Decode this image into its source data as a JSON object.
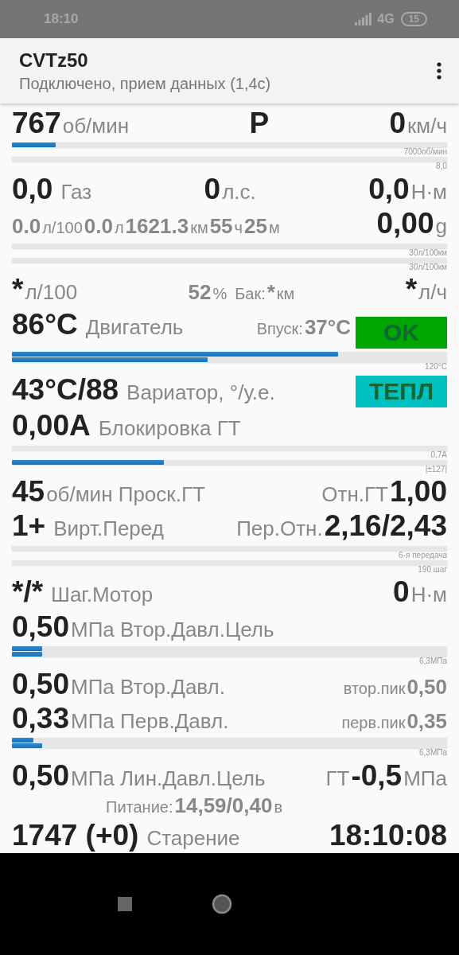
{
  "status_bar": {
    "time": "18:10",
    "network": "4G",
    "battery": "15"
  },
  "app_bar": {
    "title": "CVTz50",
    "subtitle": "Подключено, прием данных (1,4с)"
  },
  "rows": [
    {
      "kind": "values",
      "left": [
        {
          "kind": "value",
          "text": "767"
        },
        {
          "kind": "unit",
          "text": "об/мин"
        }
      ],
      "center": [
        {
          "kind": "value",
          "text": "P"
        }
      ],
      "right": [
        {
          "kind": "value",
          "text": "0"
        },
        {
          "kind": "unit",
          "text": "км/ч"
        }
      ]
    },
    {
      "kind": "bars",
      "bars": [
        {
          "level": 0.1,
          "caption": "7000об/мин"
        },
        {
          "caption": "8,0"
        }
      ]
    },
    {
      "kind": "values",
      "left": [
        {
          "kind": "value",
          "text": "0,0"
        },
        {
          "kind": "label",
          "text": "Газ"
        }
      ],
      "center": [
        {
          "kind": "value",
          "text": "0"
        },
        {
          "kind": "unit",
          "text": "л.с."
        }
      ],
      "right": [
        {
          "kind": "value",
          "text": "0,0"
        },
        {
          "kind": "unit",
          "text": "Н·м"
        }
      ]
    },
    {
      "kind": "values",
      "left": [
        {
          "kind": "dim_value",
          "text": "0.0"
        },
        {
          "kind": "small_unit",
          "text": "л/100"
        },
        {
          "kind": "dim_value",
          "text": "0.0"
        },
        {
          "kind": "small_unit",
          "text": "л"
        },
        {
          "kind": "dim_value",
          "text": "1621.3"
        },
        {
          "kind": "small_unit",
          "text": "км"
        },
        {
          "kind": "dim_value",
          "text": "55"
        },
        {
          "kind": "small_unit",
          "text": "ч"
        },
        {
          "kind": "dim_value",
          "text": "25"
        },
        {
          "kind": "small_unit",
          "text": "м"
        }
      ],
      "right": [
        {
          "kind": "value",
          "text": "0,00"
        },
        {
          "kind": "unit",
          "text": "g"
        }
      ]
    },
    {
      "kind": "bars",
      "bars": [
        {
          "caption": "30л/100км"
        },
        {
          "caption": "30л/100км"
        }
      ]
    },
    {
      "kind": "values",
      "left": [
        {
          "kind": "value",
          "text": "*"
        },
        {
          "kind": "unit",
          "text": "л/100"
        }
      ],
      "center": [
        {
          "kind": "dim_value",
          "text": "52"
        },
        {
          "kind": "small_unit",
          "text": "%"
        },
        {
          "kind": "small_label",
          "text": "Бак:"
        },
        {
          "kind": "dim_value",
          "text": "*"
        },
        {
          "kind": "small_unit",
          "text": "км"
        }
      ],
      "right": [
        {
          "kind": "value",
          "text": "*"
        },
        {
          "kind": "unit",
          "text": "л/ч"
        }
      ]
    },
    {
      "kind": "values",
      "left": [
        {
          "kind": "value",
          "text": "86°C"
        },
        {
          "kind": "label",
          "text": "Двигатель"
        }
      ],
      "right": [
        {
          "kind": "small_label",
          "text": "Впуск:"
        },
        {
          "kind": "dim_value",
          "text": "37°C"
        },
        {
          "kind": "badge",
          "text": "OK",
          "color": "#00a600"
        }
      ]
    },
    {
      "kind": "bars",
      "bars": [
        {
          "level": 0.75
        },
        {
          "level": 0.45,
          "caption": "120°C"
        }
      ]
    },
    {
      "kind": "values",
      "left": [
        {
          "kind": "value",
          "text": "43°C/88"
        },
        {
          "kind": "label",
          "text": "Вариатор, °/у.е."
        }
      ],
      "right": [
        {
          "kind": "badge",
          "text": "ТЕПЛ",
          "color": "#00c0c0"
        }
      ]
    },
    {
      "kind": "values",
      "left": [
        {
          "kind": "value",
          "text": "0,00A"
        },
        {
          "kind": "label",
          "text": "Блокировка ГТ"
        }
      ]
    },
    {
      "kind": "bars",
      "bars": [
        {
          "caption": "0,7А"
        },
        {
          "level": 0.35,
          "caption": "|±127|"
        }
      ]
    },
    {
      "kind": "values",
      "left": [
        {
          "kind": "value",
          "text": "45"
        },
        {
          "kind": "unit",
          "text": "об/мин Проск.ГТ"
        }
      ],
      "right": [
        {
          "kind": "label",
          "text": "Отн.ГТ"
        },
        {
          "kind": "value",
          "text": "1,00"
        }
      ]
    },
    {
      "kind": "values",
      "left": [
        {
          "kind": "value",
          "text": "1+"
        },
        {
          "kind": "label",
          "text": "Вирт.Перед"
        }
      ],
      "right": [
        {
          "kind": "unit",
          "text": "Пер.Отн."
        },
        {
          "kind": "value",
          "text": "2,16/2,43"
        }
      ]
    },
    {
      "kind": "bars",
      "bars": [
        {
          "caption": "6-я передача"
        },
        {
          "caption": "190 шаг"
        }
      ]
    },
    {
      "kind": "values",
      "left": [
        {
          "kind": "value",
          "text": "*/*"
        },
        {
          "kind": "label",
          "text": "Шаг.Мотор"
        }
      ],
      "right": [
        {
          "kind": "value",
          "text": "0"
        },
        {
          "kind": "unit",
          "text": "Н·м"
        }
      ]
    },
    {
      "kind": "values",
      "left": [
        {
          "kind": "value",
          "text": "0,50"
        },
        {
          "kind": "unit",
          "text": "МПа Втор.Давл.Цель"
        }
      ]
    },
    {
      "kind": "bars",
      "bars": [
        {
          "level": 0.07
        },
        {
          "level": 0.07,
          "caption": "6,3МПа"
        }
      ]
    },
    {
      "kind": "values",
      "left": [
        {
          "kind": "value",
          "text": "0,50"
        },
        {
          "kind": "unit",
          "text": "МПа Втор.Давл."
        }
      ],
      "right": [
        {
          "kind": "small_label",
          "text": "втор.пик"
        },
        {
          "kind": "dim_value",
          "text": "0,50"
        }
      ]
    },
    {
      "kind": "values",
      "left": [
        {
          "kind": "value",
          "text": "0,33"
        },
        {
          "kind": "unit",
          "text": "МПа Перв.Давл."
        }
      ],
      "right": [
        {
          "kind": "small_label",
          "text": "перв.пик"
        },
        {
          "kind": "dim_value",
          "text": "0,35"
        }
      ]
    },
    {
      "kind": "bars",
      "bars": [
        {
          "level": 0.05
        },
        {
          "level": 0.07,
          "caption": "6,3МПа"
        }
      ]
    },
    {
      "kind": "values",
      "left": [
        {
          "kind": "value",
          "text": "0,50"
        },
        {
          "kind": "unit",
          "text": "МПа Лин.Давл.Цель"
        }
      ],
      "right": [
        {
          "kind": "unit",
          "text": "ГТ"
        },
        {
          "kind": "value",
          "text": "-0,5"
        },
        {
          "kind": "unit",
          "text": "МПа"
        }
      ]
    },
    {
      "kind": "note",
      "left": [
        {
          "kind": "small_label",
          "text": "Питание:"
        },
        {
          "kind": "dim_value",
          "text": "14,59/0,40"
        },
        {
          "kind": "small_unit",
          "text": "в"
        }
      ]
    },
    {
      "kind": "values",
      "left": [
        {
          "kind": "value",
          "text": "1747 (+0)"
        },
        {
          "kind": "label",
          "text": "Старение"
        }
      ],
      "right": [
        {
          "kind": "value",
          "text": "18:10:08"
        }
      ]
    }
  ]
}
